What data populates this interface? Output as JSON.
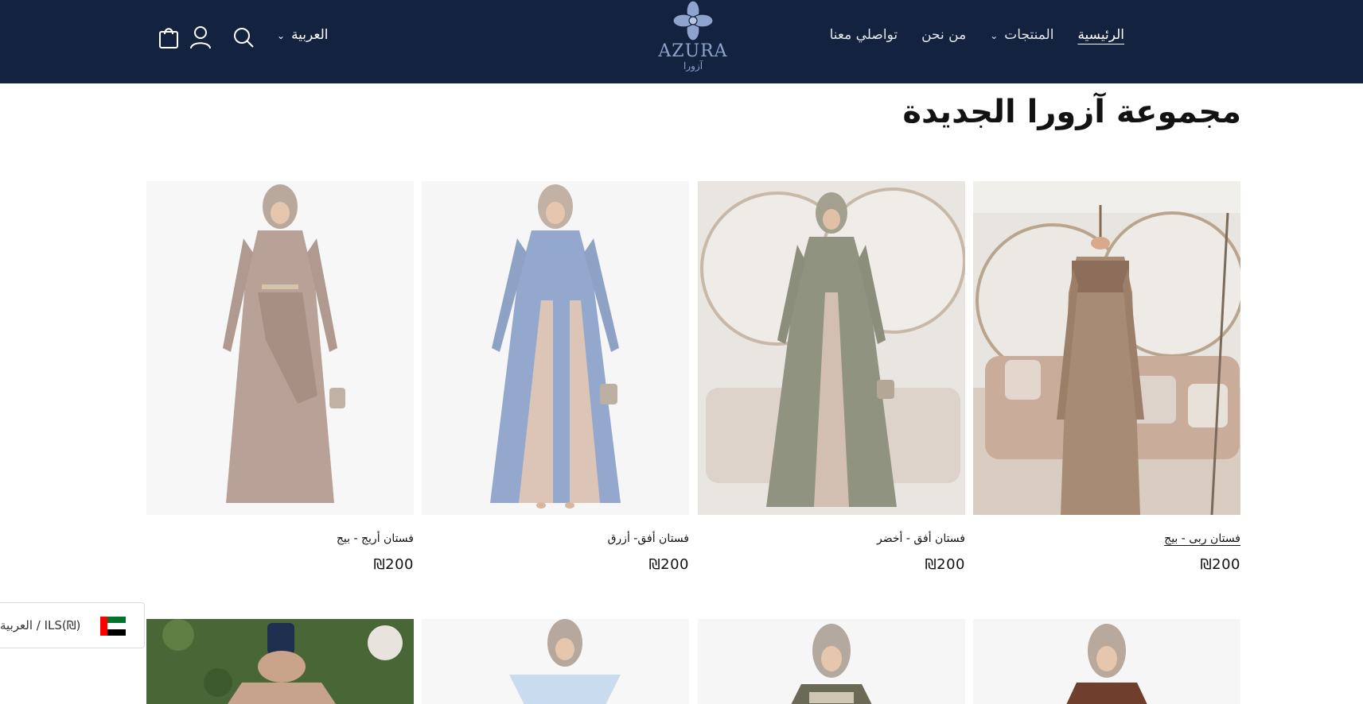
{
  "header": {
    "nav": [
      {
        "label": "الرئيسية",
        "active": true,
        "dropdown": false
      },
      {
        "label": "المنتجات",
        "active": false,
        "dropdown": true
      },
      {
        "label": "من نحن",
        "active": false,
        "dropdown": false
      },
      {
        "label": "تواصلي معنا",
        "active": false,
        "dropdown": false
      }
    ],
    "logo_text": "AZURA",
    "logo_sub": "آزورا",
    "language": "العربية",
    "icons": [
      "search-icon",
      "account-icon",
      "cart-icon"
    ]
  },
  "main": {
    "title": "مجموعة آزورا الجديدة",
    "products": [
      {
        "title": "فستان ربى - بيج",
        "price": "₪200"
      },
      {
        "title": "فستان أفق - أخضر",
        "price": "₪200"
      },
      {
        "title": "فستان أفق- أزرق",
        "price": "₪200"
      },
      {
        "title": "فستان أريج - بيج",
        "price": "₪200"
      }
    ]
  },
  "currency_badge": {
    "text": "العربية / ILS(₪)"
  },
  "colors": {
    "header_bg": "#13223f",
    "logo": "#8ea4cf"
  }
}
